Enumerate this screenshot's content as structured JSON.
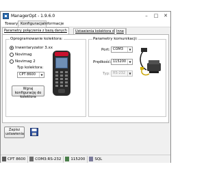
{
  "window": {
    "title": "ManagerOpt - 1.9.6.0"
  },
  "menu": [
    {
      "label": "Towary"
    },
    {
      "label": "Konfiguracja"
    },
    {
      "label": "Informacje"
    }
  ],
  "subtabs": [
    {
      "label": "Parametry połączenia z bazą danych"
    },
    {
      "label": "Ustawienia kolektora danych"
    },
    {
      "label": "Inne"
    }
  ],
  "software_group": {
    "legend": "Oprogramowanie kolektora:",
    "options": [
      {
        "label": "Inwentaryzator 3.xx",
        "selected": true
      },
      {
        "label": "Novimag",
        "selected": false
      },
      {
        "label": "Novimag 2",
        "selected": false
      }
    ],
    "type_label": "Typ kolektora:",
    "type_value": "CPT 8600",
    "upload_button": "Wgraj konfigurację do kolektora"
  },
  "comm_group": {
    "legend": "Parametry komunikacji:",
    "port_label": "Port:",
    "port_value": "COM3",
    "speed_label": "Prędkość:",
    "speed_value": "115200",
    "type_label": "Typ:",
    "type_value": "RS-232"
  },
  "save_button": "Zapisz ustawienia",
  "statusbar": [
    {
      "icon": "device-icon",
      "text": "CPT 8600"
    },
    {
      "icon": "port-icon",
      "text": "COM3:RS-232"
    },
    {
      "icon": "speed-icon",
      "text": "115200"
    },
    {
      "icon": "database-icon",
      "text": "SQL"
    }
  ]
}
